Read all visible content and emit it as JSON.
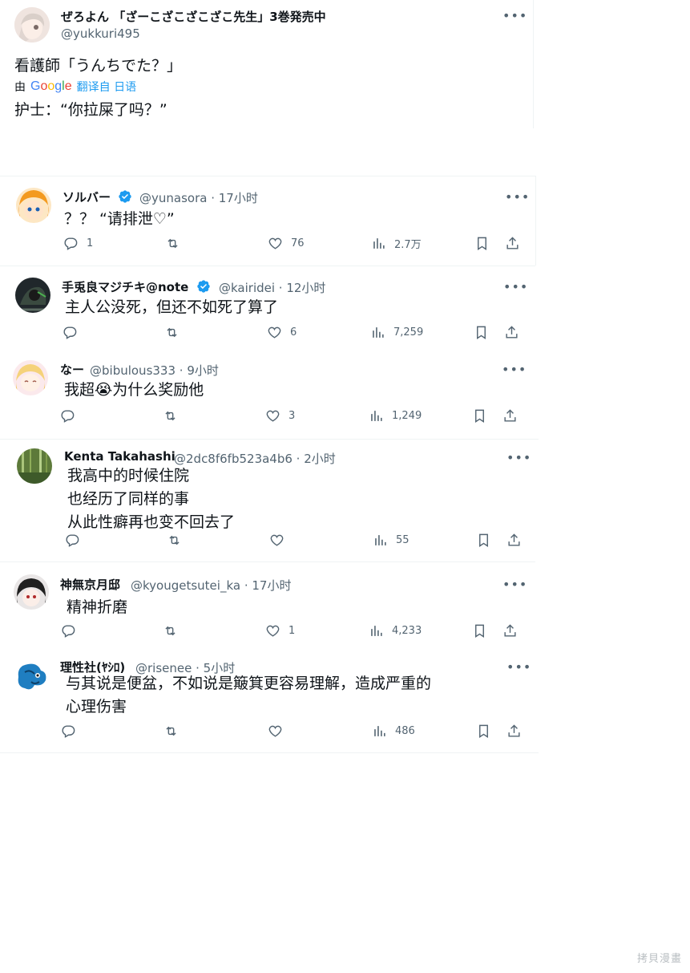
{
  "main_post": {
    "name": "ぜろよん 「ざーこざこざこざこ先生」3巻発売中",
    "handle": "@yukkuri495",
    "text": "看護師「うんちでた？」",
    "translate_by": "由",
    "google_logo": "Google",
    "translate_from": "翻译自 日语",
    "translation": "护士：“你拉屎了吗？”"
  },
  "replies": [
    {
      "name": "ソルバー",
      "handle": "@yunasora · 17小时",
      "verified": true,
      "lines": [
        "？？ “请排泄♡”"
      ],
      "replies": "1",
      "retweets": "",
      "likes": "76",
      "views": "2.7万"
    },
    {
      "name": "手兎良マジチキ@note",
      "handle": "@kairidei · 12小时",
      "verified": true,
      "lines": [
        "主人公没死，但还不如死了算了"
      ],
      "replies": "",
      "retweets": "",
      "likes": "6",
      "views": "7,259"
    },
    {
      "name": "なー",
      "handle": "@bibulous333 · 9小时",
      "verified": false,
      "lines": [
        "我超😭为什么奖励他"
      ],
      "replies": "",
      "retweets": "",
      "likes": "3",
      "views": "1,249"
    },
    {
      "name": "Kenta Takahashi",
      "handle": "@2dc8f6fb523a4b6 · 2小时",
      "verified": false,
      "lines": [
        "我高中的时候住院",
        "也经历了同样的事",
        "从此性癖再也变不回去了"
      ],
      "replies": "",
      "retweets": "",
      "likes": "",
      "views": "55"
    },
    {
      "name": "神無京月邸",
      "handle": "@kyougetsutei_ka · 17小时",
      "verified": false,
      "lines": [
        "精神折磨"
      ],
      "replies": "",
      "retweets": "",
      "likes": "1",
      "views": "4,233"
    },
    {
      "name": "理性社(ﾔｼﾛ)",
      "handle": "@risenee · 5小时",
      "verified": false,
      "lines": [
        "与其说是便盆，不如说是簸箕更容易理解，造成严重的",
        "心理伤害"
      ],
      "replies": "",
      "retweets": "",
      "likes": "",
      "views": "486"
    }
  ],
  "icons": {
    "reply": "reply-icon",
    "retweet": "retweet-icon",
    "like": "heart-icon",
    "views": "views-icon",
    "bookmark": "bookmark-icon",
    "share": "share-icon",
    "more": "more-icon",
    "verified": "verified-badge-icon"
  },
  "colors": {
    "accent": "#1d9bf0",
    "secondary_text": "#536471",
    "divider": "#eff3f4"
  },
  "watermark": "拷貝漫畫"
}
